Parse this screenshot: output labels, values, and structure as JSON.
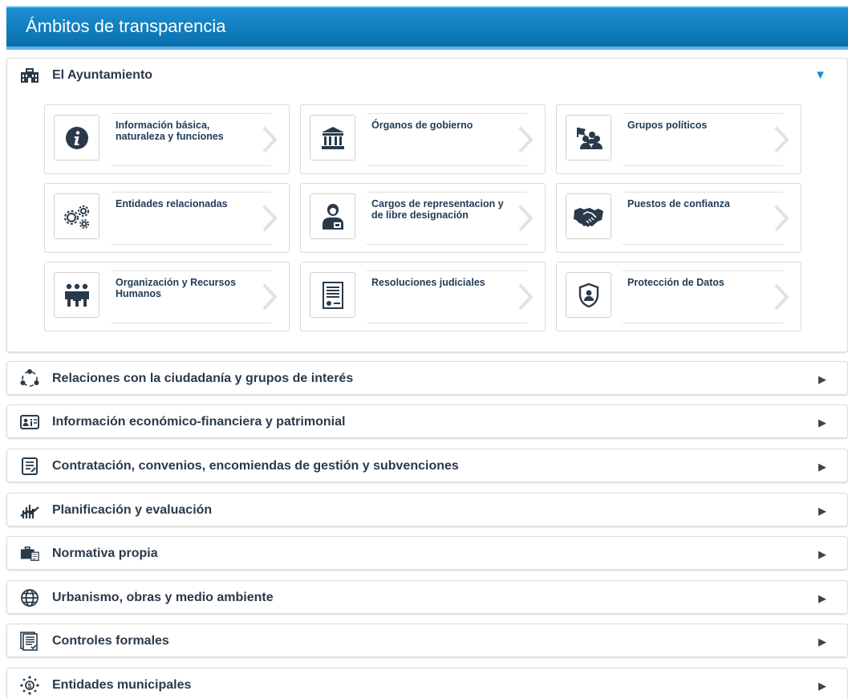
{
  "header": {
    "title": "Ámbitos de transparencia"
  },
  "colors": {
    "brand": "#0a6fad",
    "accent": "#1a8fd6",
    "text": "#2a3a4a"
  },
  "sections": [
    {
      "title": "El Ayuntamiento",
      "icon": "building-icon",
      "expanded": true,
      "cards": [
        {
          "label": "Información básica, naturaleza y funciones",
          "icon": "info-icon"
        },
        {
          "label": "Órganos de gobierno",
          "icon": "government-building-icon"
        },
        {
          "label": "Grupos políticos",
          "icon": "political-groups-icon"
        },
        {
          "label": "Entidades relacionadas",
          "icon": "gears-icon"
        },
        {
          "label": "Cargos de representacion y de libre designación",
          "icon": "representative-icon"
        },
        {
          "label": "Puestos de confianza",
          "icon": "handshake-icon"
        },
        {
          "label": "Organización y Recursos Humanos",
          "icon": "people-icon"
        },
        {
          "label": "Resoluciones judiciales",
          "icon": "document-seal-icon"
        },
        {
          "label": "Protección de Datos",
          "icon": "shield-user-icon"
        }
      ]
    },
    {
      "title": "Relaciones con la ciudadanía y grupos de interés",
      "icon": "people-cycle-icon",
      "expanded": false
    },
    {
      "title": "Información económico-financiera y patrimonial",
      "icon": "finance-card-icon",
      "expanded": false
    },
    {
      "title": "Contratación, convenios, encomiendas de gestión y subvenciones",
      "icon": "contract-icon",
      "expanded": false
    },
    {
      "title": "Planificación y evaluación",
      "icon": "planning-icon",
      "expanded": false
    },
    {
      "title": "Normativa propia",
      "icon": "briefcase-document-icon",
      "expanded": false
    },
    {
      "title": "Urbanismo, obras y medio ambiente",
      "icon": "globe-icon",
      "expanded": false
    },
    {
      "title": "Controles formales",
      "icon": "checklist-icon",
      "expanded": false
    },
    {
      "title": "Entidades municipales",
      "icon": "entities-network-icon",
      "expanded": false
    }
  ]
}
